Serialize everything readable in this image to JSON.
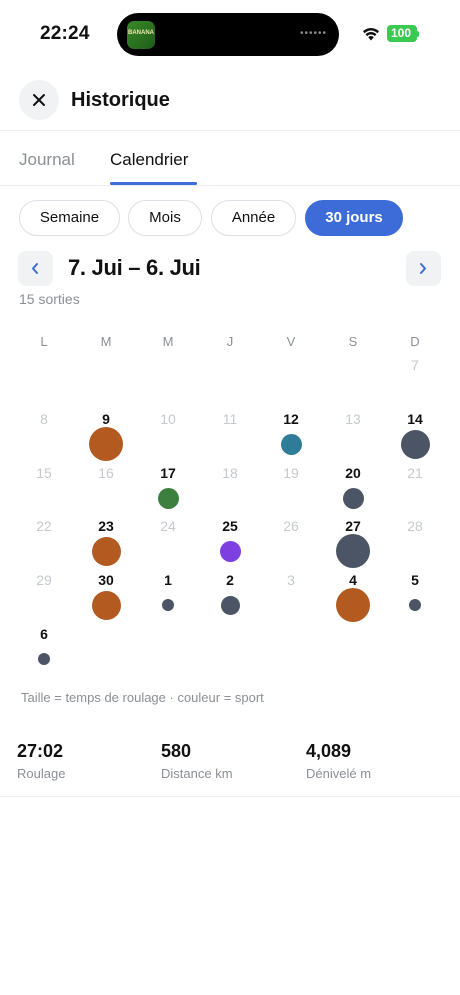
{
  "status_bar": {
    "time": "22:24",
    "battery": "100",
    "island_app_label": "BANANA",
    "island_dots": "••••••"
  },
  "header": {
    "title": "Historique",
    "close_icon": "close-icon"
  },
  "tabs": [
    {
      "label": "Journal",
      "active": false
    },
    {
      "label": "Calendrier",
      "active": true
    }
  ],
  "ranges": [
    {
      "label": "Semaine",
      "active": false
    },
    {
      "label": "Mois",
      "active": false
    },
    {
      "label": "Année",
      "active": false
    },
    {
      "label": "30 jours",
      "active": true
    }
  ],
  "period": {
    "title": "7. Jui – 6. Jui",
    "count": "15 sorties",
    "prev_icon": "chevron-left-icon",
    "next_icon": "chevron-right-icon"
  },
  "calendar": {
    "weekdays": [
      "L",
      "M",
      "M",
      "J",
      "V",
      "S",
      "D"
    ],
    "weeks": [
      [
        {
          "d": ""
        },
        {
          "d": ""
        },
        {
          "d": ""
        },
        {
          "d": ""
        },
        {
          "d": ""
        },
        {
          "d": ""
        },
        {
          "d": "7",
          "muted": true
        }
      ],
      [
        {
          "d": "8",
          "muted": true
        },
        {
          "d": "9",
          "sport": "orange",
          "size": "large"
        },
        {
          "d": "10",
          "muted": true
        },
        {
          "d": "11",
          "muted": true
        },
        {
          "d": "12",
          "sport": "teal",
          "size": "small"
        },
        {
          "d": "13",
          "muted": true
        },
        {
          "d": "14",
          "sport": "slate",
          "size": "medium"
        }
      ],
      [
        {
          "d": "15",
          "muted": true
        },
        {
          "d": "16",
          "muted": true
        },
        {
          "d": "17",
          "sport": "green",
          "size": "small"
        },
        {
          "d": "18",
          "muted": true
        },
        {
          "d": "19",
          "muted": true
        },
        {
          "d": "20",
          "sport": "slate",
          "size": "small"
        },
        {
          "d": "21",
          "muted": true
        }
      ],
      [
        {
          "d": "22",
          "muted": true
        },
        {
          "d": "23",
          "sport": "orange",
          "size": "medium"
        },
        {
          "d": "24",
          "muted": true
        },
        {
          "d": "25",
          "sport": "purple",
          "size": "small"
        },
        {
          "d": "26",
          "muted": true
        },
        {
          "d": "27",
          "sport": "slate",
          "size": "large"
        },
        {
          "d": "28",
          "muted": true
        }
      ],
      [
        {
          "d": "29",
          "muted": true
        },
        {
          "d": "30",
          "sport": "orange",
          "size": "medium"
        },
        {
          "d": "1",
          "sport": "slate",
          "size": "tiny"
        },
        {
          "d": "2",
          "sport": "slate",
          "size": "xsmall"
        },
        {
          "d": "3",
          "muted": true
        },
        {
          "d": "4",
          "sport": "orange",
          "size": "large"
        },
        {
          "d": "5",
          "sport": "slate",
          "size": "tiny"
        }
      ],
      [
        {
          "d": "6",
          "sport": "slate",
          "size": "tiny"
        },
        {
          "d": ""
        },
        {
          "d": ""
        },
        {
          "d": ""
        },
        {
          "d": ""
        },
        {
          "d": ""
        },
        {
          "d": ""
        }
      ]
    ],
    "sport_colors": {
      "orange": "#b25a20",
      "slate": "#4b5565",
      "teal": "#2f7c98",
      "green": "#3c7f3e",
      "purple": "#7d3fe0"
    }
  },
  "legend": "Taille = temps de roulage · couleur = sport",
  "summary": [
    {
      "value": "27:02",
      "label": "Roulage"
    },
    {
      "value": "580",
      "label": "Distance km"
    },
    {
      "value": "4,089",
      "label": "Dénivelé m"
    }
  ]
}
